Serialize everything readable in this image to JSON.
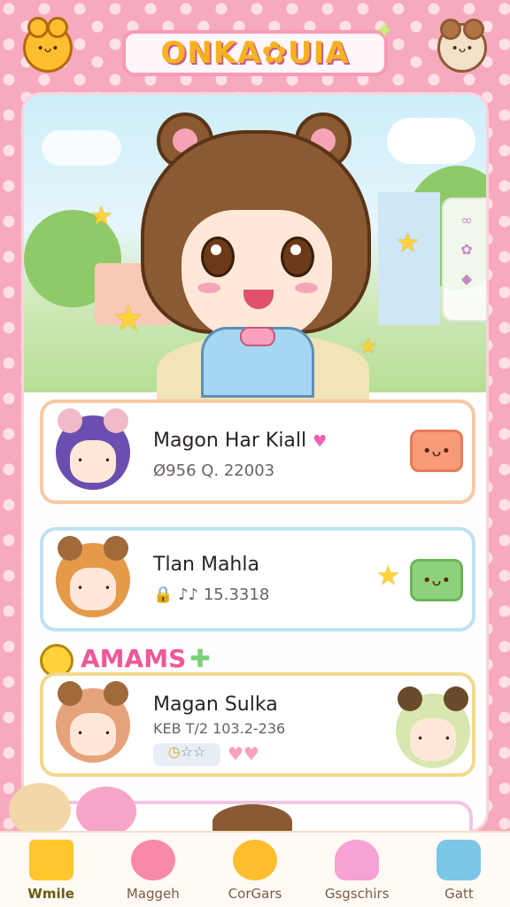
{
  "app": {
    "logo_text": "ONKA✿UIA",
    "sparkle": "✦"
  },
  "cards": [
    {
      "name": "Magon Har Kiall",
      "meta": "Ø956  Q. 22003",
      "button_icon": "•ᴗ•",
      "border_color": "#f7c9a3",
      "button_color": "#f79b78"
    },
    {
      "name": "Tlan Mahla",
      "meta": "🔒 ♪♪  15.3318",
      "button_icon": "•ᴗ•",
      "border_color": "#bfe1f2",
      "button_color": "#8fd17a"
    },
    {
      "name": "Magan Sulka",
      "meta": "KEB T/2  103.2-236",
      "rating": "☆☆",
      "border_color": "#f3d98a"
    }
  ],
  "section": {
    "title": "AMAMS",
    "plus": "✚"
  },
  "nav": [
    {
      "label": "Wmile",
      "icon": "home-icon",
      "color": "#ffc62e",
      "active": true
    },
    {
      "label": "Maggeh",
      "icon": "bear-icon",
      "color": "#f88aa6",
      "active": false
    },
    {
      "label": "CorGars",
      "icon": "bear-face-icon",
      "color": "#ffbe2e",
      "active": false
    },
    {
      "label": "Gsgschirs",
      "icon": "heart-icon",
      "color": "#f7a1d4",
      "active": false
    },
    {
      "label": "Gatt",
      "icon": "candy-icon",
      "color": "#7cc6e8",
      "active": false
    }
  ]
}
